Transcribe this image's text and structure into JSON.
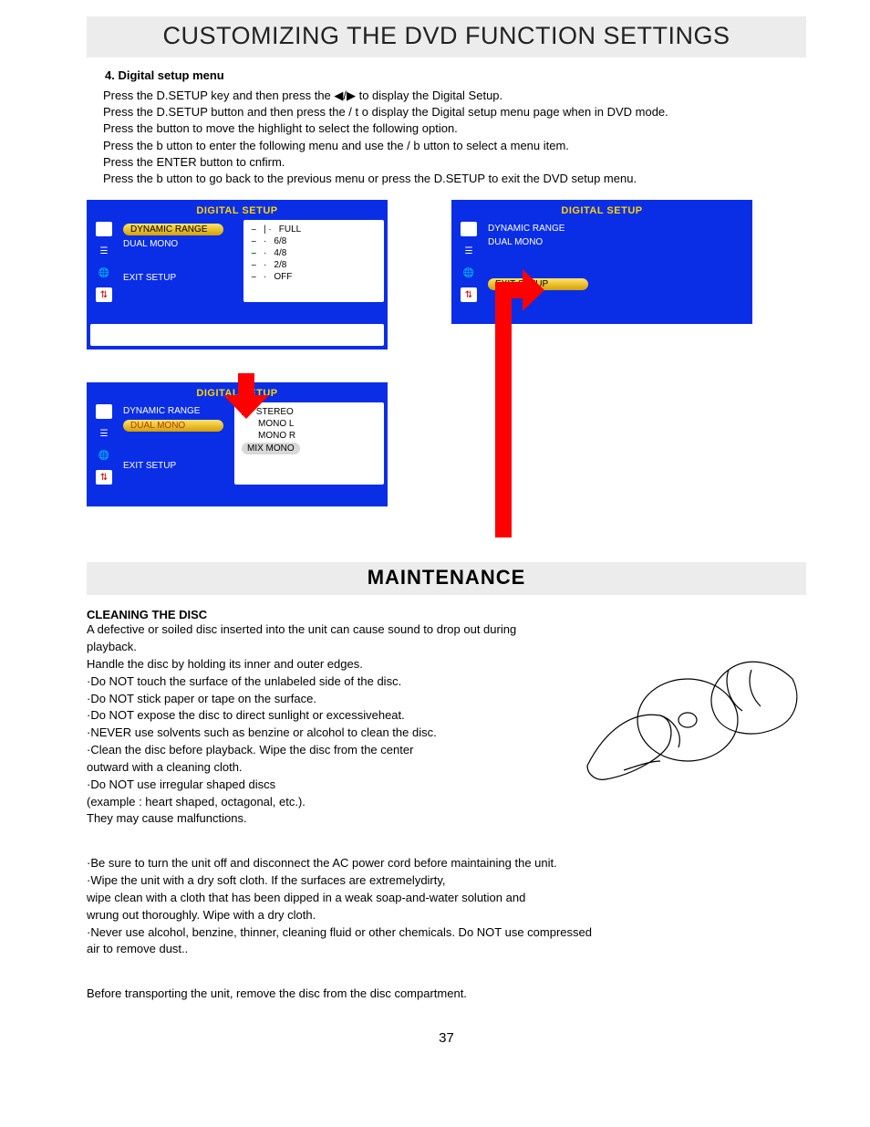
{
  "header": {
    "title": "CUSTOMIZING THE DVD FUNCTION SETTINGS"
  },
  "section": {
    "heading": "4. Digital setup menu",
    "lines": [
      "Press the D.SETUP key and then press the ◀/▶ to display the Digital Setup.",
      "Press the D.SETUP button and then press the    / t   o display the Digital setup menu page when in DVD mode.",
      "Press the    button to move the highlight to select the following option.",
      "Press the  b   utton to enter the following menu and use the    / b   utton to select a menu item.",
      "Press the ENTER button to cnfirm.",
      "Press the  b   utton to go back to the previous menu or press the D.SETUP to exit the DVD setup menu."
    ]
  },
  "osd": {
    "title": "DIGITAL SETUP",
    "items": {
      "dynamic_range": "DYNAMIC RANGE",
      "dual_mono": "DUAL  MONO",
      "exit_setup": "EXIT SETUP"
    },
    "range_opts": [
      "FULL",
      "6/8",
      "4/8",
      "2/8",
      "OFF"
    ],
    "mono_opts": [
      "STEREO",
      "MONO  L",
      "MONO  R",
      "MIX  MONO"
    ]
  },
  "maintenance": {
    "title": "MAINTENANCE",
    "cleaning_heading": "CLEANING THE DISC",
    "intro": "A defective or soiled disc inserted into the unit can cause sound to drop out during",
    "lines1": [
      " playback.",
      " Handle the disc by holding its inner and outer edges.",
      "·Do NOT touch the surface of the unlabeled side of the disc.",
      "·Do NOT stick paper or tape on the surface.",
      "·Do NOT expose the disc to direct sunlight or excessiveheat.",
      "·NEVER use solvents such as benzine or alcohol to clean the disc.",
      "·Clean the disc before playback. Wipe the disc from the center",
      "outward with a cleaning cloth.",
      "·Do NOT use irregular shaped discs",
      " (example : heart shaped, octagonal, etc.).",
      " They may cause malfunctions."
    ],
    "lines2": [
      "·Be sure to turn the unit off and disconnect the AC power cord before maintaining the unit.",
      "·Wipe the unit with a dry soft cloth. If the surfaces are extremelydirty,",
      "wipe clean with a cloth that has been dipped in a weak soap-and-water solution and",
      "wrung out thoroughly. Wipe with a dry cloth.",
      "·Never use alcohol, benzine, thinner, cleaning fluid or other chemicals. Do NOT use compressed",
      "air to remove dust.."
    ],
    "transport": "Before transporting the unit, remove the disc from the disc compartment."
  },
  "page_number": "37"
}
